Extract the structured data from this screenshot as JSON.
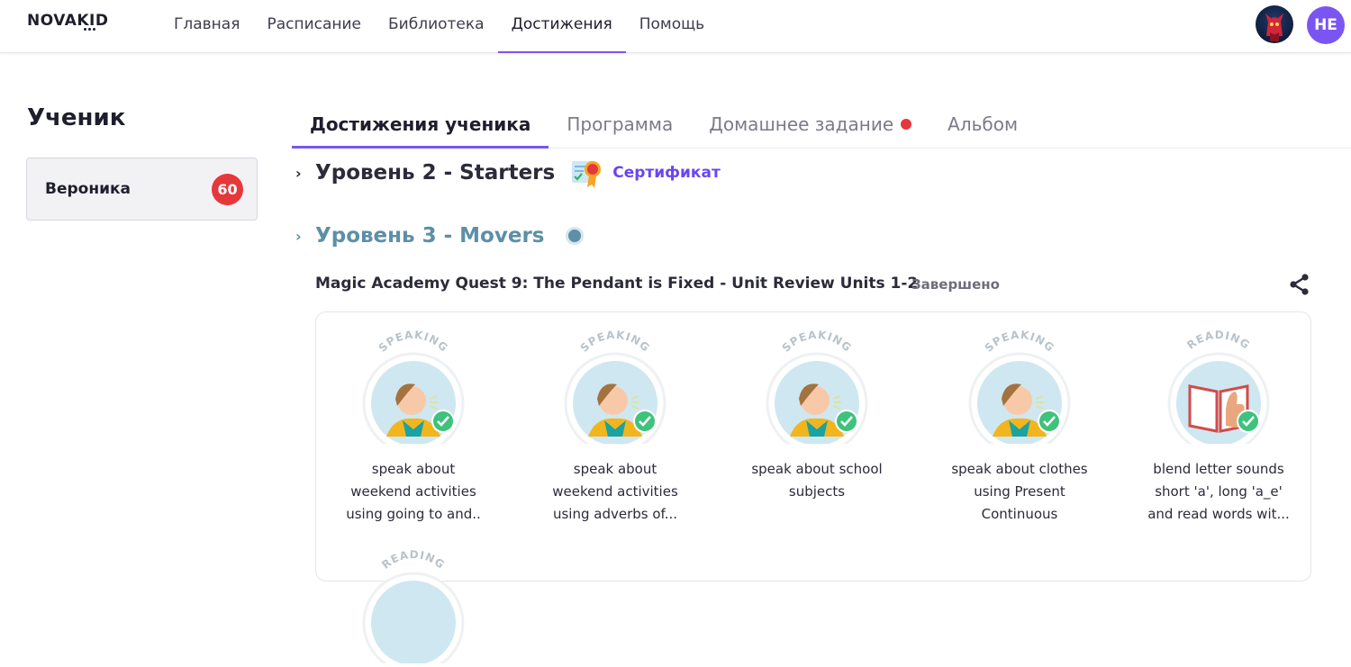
{
  "app": {
    "logo_text": "NOVAKID",
    "nav": [
      {
        "label": "Главная"
      },
      {
        "label": "Расписание"
      },
      {
        "label": "Библиотека"
      },
      {
        "label": "Достижения",
        "active": true
      },
      {
        "label": "Помощь"
      }
    ],
    "user_initials": "HE",
    "accent_color": "#7b55f2"
  },
  "sidebar": {
    "title": "Ученик",
    "student": {
      "name": "Вероника",
      "badge_count": "60"
    }
  },
  "tabs": [
    {
      "label": "Достижения ученика",
      "active": true
    },
    {
      "label": "Программа"
    },
    {
      "label": "Домашнее задание",
      "has_notification": true
    },
    {
      "label": "Альбом"
    }
  ],
  "levels": [
    {
      "title": "Уровень 2 - Starters",
      "certificate_label": "Сертификат",
      "icons": [
        "chevron-right-icon",
        "certificate-icon"
      ]
    },
    {
      "title": "Уровень 3 - Movers",
      "status_color": "#5d8fa8",
      "icons": [
        "chevron-right-icon",
        "status-dot-icon"
      ]
    }
  ],
  "quest": {
    "title": "Magic Academy Quest 9: The Pendant is Fixed - Unit Review Units 1-2",
    "status": "Завершено",
    "share_icon": "share-icon"
  },
  "skills": [
    {
      "category": "SPEAKING",
      "label_lines": [
        "speak about",
        "weekend activities",
        "using going to and.."
      ],
      "completed": true
    },
    {
      "category": "SPEAKING",
      "label_lines": [
        "speak about",
        "weekend activities",
        "using adverbs of..."
      ],
      "completed": true
    },
    {
      "category": "SPEAKING",
      "label_lines": [
        "speak about school",
        "subjects"
      ],
      "completed": true
    },
    {
      "category": "SPEAKING",
      "label_lines": [
        "speak about clothes",
        "using Present",
        "Continuous"
      ],
      "completed": true
    },
    {
      "category": "READING",
      "label_lines": [
        "blend letter sounds",
        "short 'a', long 'a_e'",
        "and read words wit..."
      ],
      "completed": true
    },
    {
      "category": "READING",
      "label_lines": [],
      "completed": false
    }
  ]
}
